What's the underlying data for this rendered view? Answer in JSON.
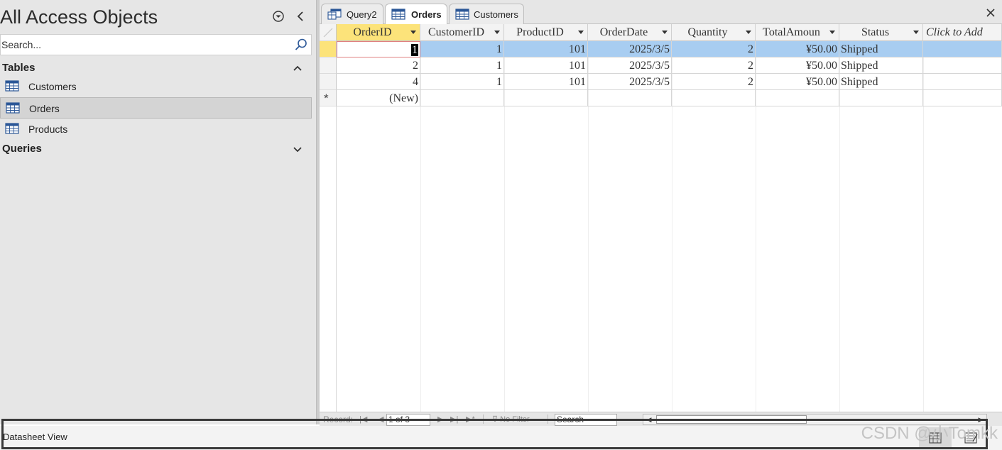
{
  "nav": {
    "title": "All Access Objects",
    "search_placeholder": "Search...",
    "groups": [
      {
        "label": "Tables",
        "expanded": true,
        "items": [
          {
            "label": "Customers",
            "icon": "table-icon",
            "selected": false
          },
          {
            "label": "Orders",
            "icon": "table-icon",
            "selected": true
          },
          {
            "label": "Products",
            "icon": "table-icon",
            "selected": false
          }
        ]
      },
      {
        "label": "Queries",
        "expanded": false,
        "items": []
      }
    ]
  },
  "tabs": [
    {
      "label": "Query2",
      "icon": "query-icon",
      "active": false
    },
    {
      "label": "Orders",
      "icon": "table-icon",
      "active": true
    },
    {
      "label": "Customers",
      "icon": "table-icon",
      "active": false
    }
  ],
  "datasheet": {
    "columns": [
      "OrderID",
      "CustomerID",
      "ProductID",
      "OrderDate",
      "Quantity",
      "TotalAmoun",
      "Status"
    ],
    "add_column_label": "Click to Add",
    "rows": [
      [
        "1",
        "1",
        "101",
        "2025/3/5",
        "2",
        "¥50.00",
        "Shipped"
      ],
      [
        "2",
        "1",
        "101",
        "2025/3/5",
        "2",
        "¥50.00",
        "Shipped"
      ],
      [
        "4",
        "1",
        "101",
        "2025/3/5",
        "2",
        "¥50.00",
        "Shipped"
      ]
    ],
    "new_row_marker": "*",
    "new_row_label": "(New)"
  },
  "record_nav": {
    "record_label": "Record:",
    "position": "1 of 3",
    "filter_label": "No Filter",
    "search_label": "Search"
  },
  "status": {
    "view_text": "Datasheet View"
  },
  "watermark": "CSDN @小Tomkk",
  "colors": {
    "selected_row": "#a8cdf1",
    "selected_header": "#fce37a",
    "nav_bg": "#e6e6e6"
  }
}
